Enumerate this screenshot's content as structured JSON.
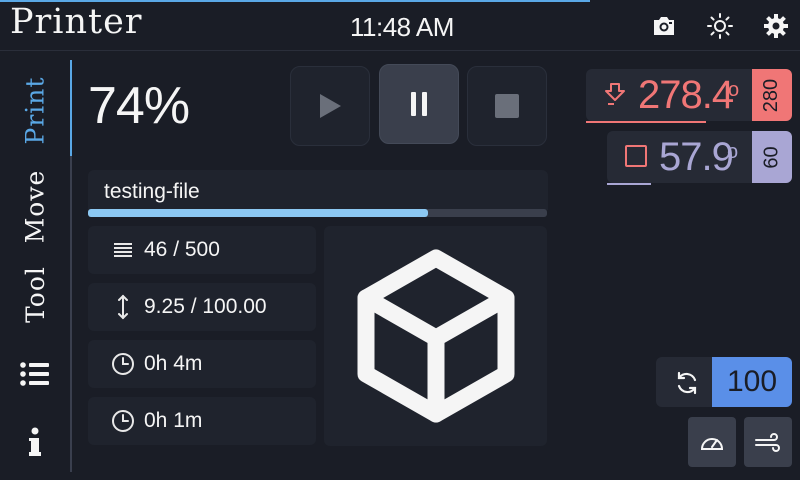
{
  "header": {
    "title": "Printer",
    "time": "11:48 AM",
    "icons": [
      "camera-icon",
      "brightness-icon",
      "settings-icon"
    ]
  },
  "nav": {
    "items": [
      {
        "label": "Print",
        "active": true
      },
      {
        "label": "Move",
        "active": false
      },
      {
        "label": "Tool",
        "active": false
      },
      {
        "icon": "list-icon"
      },
      {
        "icon": "info-icon"
      }
    ]
  },
  "print": {
    "percent": "74%",
    "progress": 0.74,
    "file_name": "testing-file",
    "layers": "46 / 500",
    "height": "9.25 / 100.00",
    "elapsed": "0h 4m",
    "remaining": "0h 1m"
  },
  "temps": {
    "extruder": {
      "current": "278.4",
      "degree": "o",
      "target": "280",
      "color": "#f07676"
    },
    "bed": {
      "current": "57.9",
      "degree": "o",
      "target": "60",
      "color": "#a9a6d4"
    }
  },
  "speed": {
    "value": "100",
    "color": "#5a8fe8"
  },
  "colors": {
    "accent": "#5aa8e6",
    "progress_fill": "#8cc8f2",
    "background": "#1a1d26"
  }
}
